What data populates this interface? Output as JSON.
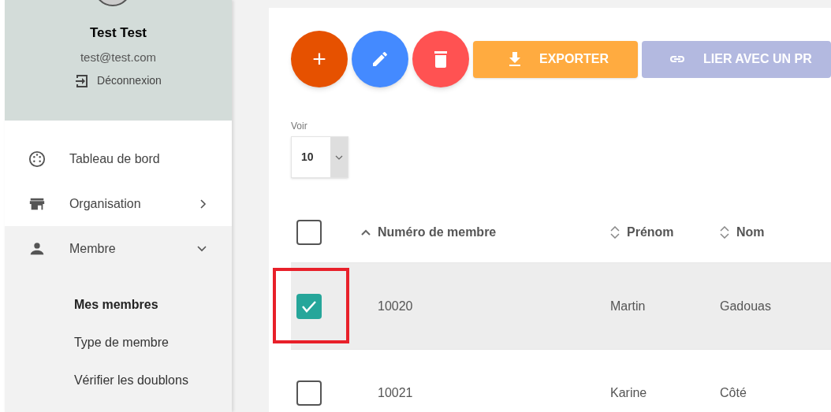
{
  "profile": {
    "name": "Test Test",
    "email": "test@test.com",
    "logout": "Déconnexion"
  },
  "menu": [
    {
      "label": "Tableau de bord",
      "kind": "dashboard",
      "expanded": false,
      "has_children": false
    },
    {
      "label": "Organisation",
      "kind": "store",
      "expanded": false,
      "has_children": true
    },
    {
      "label": "Membre",
      "kind": "person",
      "expanded": true,
      "has_children": true,
      "children": [
        {
          "label": "Mes membres",
          "selected": true
        },
        {
          "label": "Type de membre",
          "selected": false
        },
        {
          "label": "Vérifier les doublons",
          "selected": false
        }
      ]
    }
  ],
  "toolbar": {
    "round_buttons": [
      {
        "kind": "add",
        "label": "+",
        "color": "#e65100"
      },
      {
        "kind": "edit",
        "color": "#448aff"
      },
      {
        "kind": "delete",
        "color": "#ff5252"
      }
    ],
    "buttons": [
      {
        "kind": "download",
        "label": "EXPORTER",
        "disabled": false
      },
      {
        "kind": "link",
        "label": "LIER AVEC UN PR",
        "disabled": true
      }
    ]
  },
  "page_size": {
    "label": "Voir",
    "value": "10"
  },
  "table": {
    "all_checked": false,
    "columns": [
      {
        "label": "Numéro de membre",
        "kind": "sorted_ascending"
      },
      {
        "label": "Prénom",
        "kind": "sortable"
      },
      {
        "label": "Nom",
        "kind": "sortable"
      }
    ],
    "rows": [
      {
        "cells": [
          "10020",
          "Martin",
          "Gadouas"
        ],
        "selected": true,
        "highlighted": true
      },
      {
        "cells": [
          "10021",
          "Karine",
          "Côté"
        ],
        "selected": false,
        "highlighted": false
      }
    ]
  }
}
